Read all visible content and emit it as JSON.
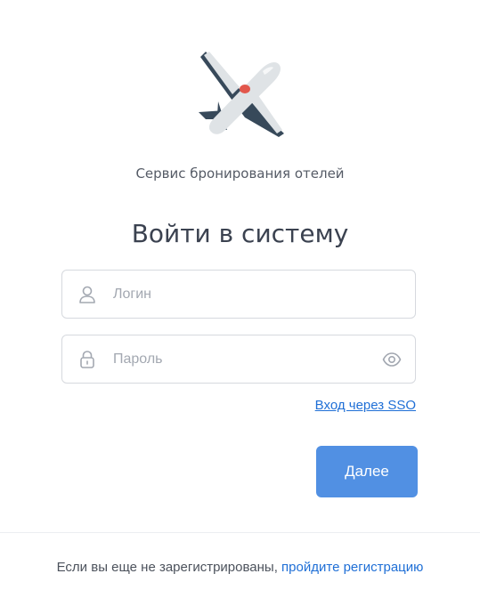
{
  "app": {
    "subtitle": "Сервис бронирования отелей",
    "logo_icon": "airplane-icon"
  },
  "login_form": {
    "title": "Войти в систему",
    "login_field": {
      "placeholder": "Логин",
      "value": "",
      "icon": "user-icon"
    },
    "password_field": {
      "placeholder": "Пароль",
      "value": "",
      "icon": "lock-icon",
      "toggle_icon": "eye-icon"
    },
    "sso_link": "Вход через SSO",
    "submit_label": "Далее"
  },
  "footer": {
    "text": "Если вы еще не зарегистрированы,",
    "link": "пройдите регистрацию"
  },
  "colors": {
    "accent": "#5190e3",
    "link": "#1f6fd6",
    "plane_body": "#dfe3e6",
    "plane_wing": "#37495a",
    "plane_dot": "#e2574c"
  }
}
